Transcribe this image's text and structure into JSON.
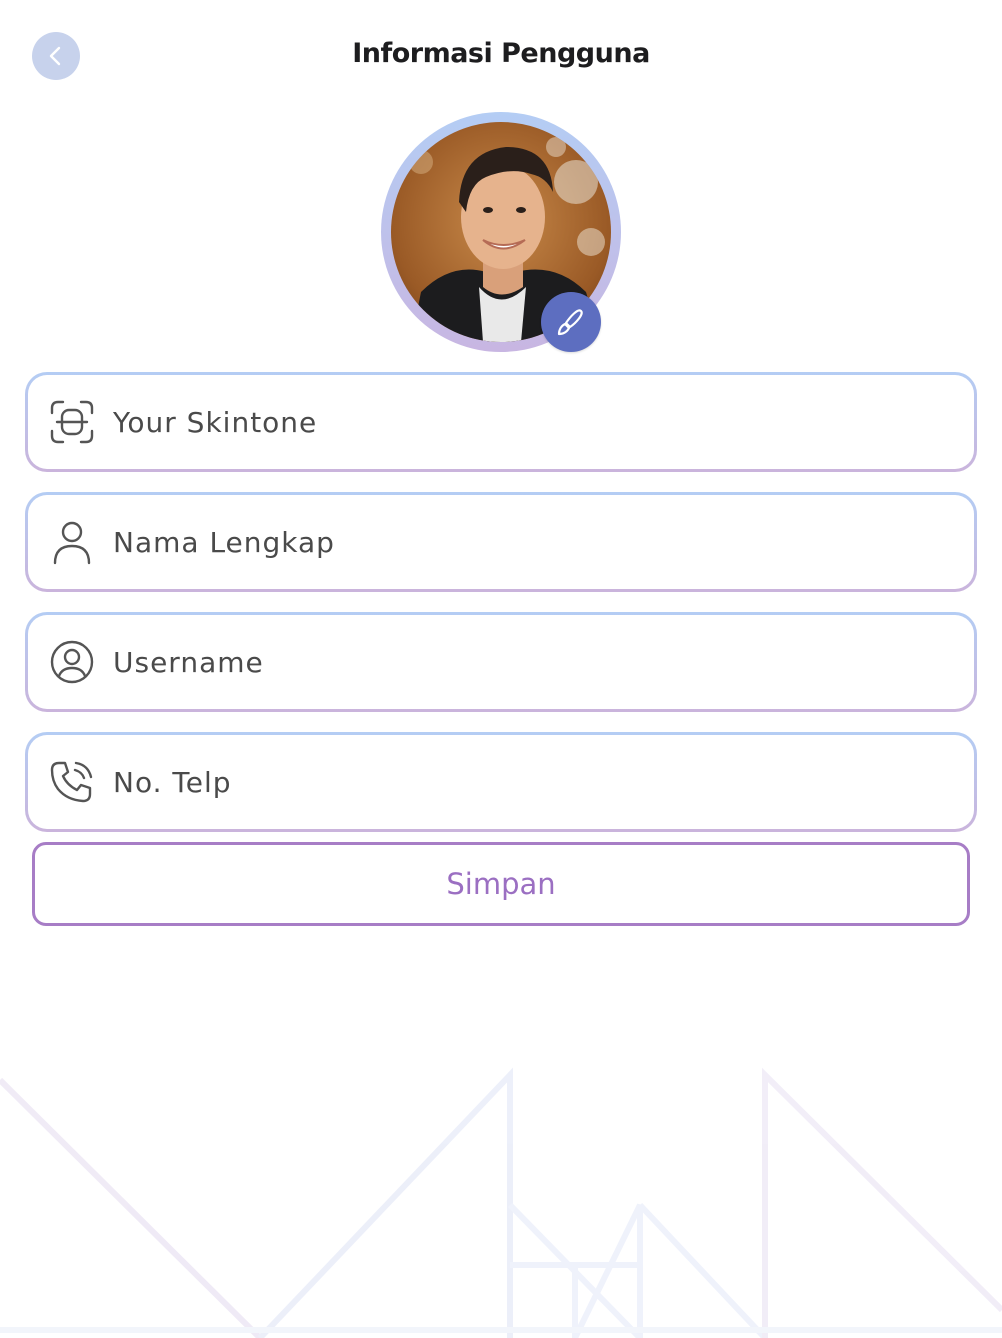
{
  "header": {
    "title": "Informasi Pengguna",
    "back_icon": "chevron-left-icon"
  },
  "profile": {
    "edit_icon": "brush-icon"
  },
  "form": {
    "fields": [
      {
        "name": "skintone",
        "placeholder": "Your Skintone",
        "icon": "face-scan-icon"
      },
      {
        "name": "full-name",
        "placeholder": "Nama Lengkap",
        "icon": "user-icon"
      },
      {
        "name": "username",
        "placeholder": "Username",
        "icon": "user-circle-icon"
      },
      {
        "name": "phone",
        "placeholder": "No. Telp",
        "icon": "phone-icon"
      }
    ],
    "save_label": "Simpan"
  },
  "colors": {
    "accent": "#9b6fc2",
    "border_top": "#b4cdf4",
    "border_bottom": "#cab4dc",
    "badge": "#5d6ec0",
    "back_button": "#c7d2ec"
  }
}
